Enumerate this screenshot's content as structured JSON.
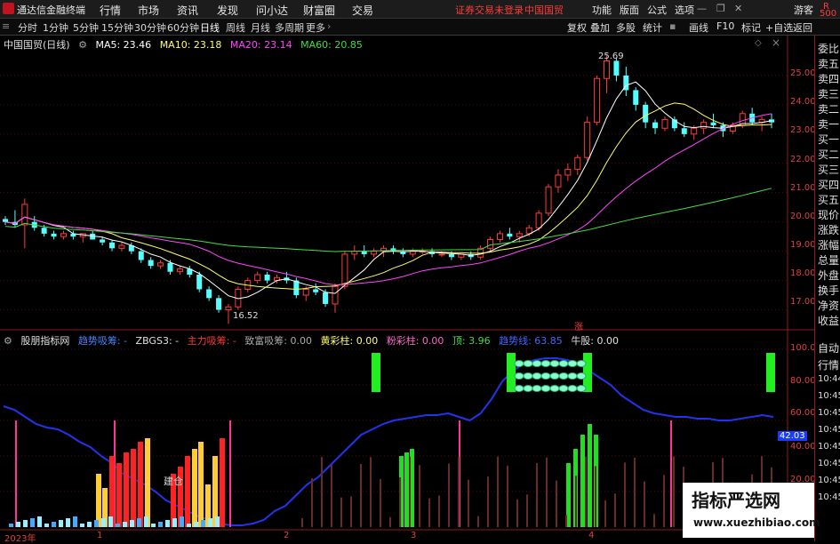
{
  "app": {
    "title": "通达信金融终端"
  },
  "menu": [
    "行情",
    "市场",
    "资讯",
    "发现",
    "问小达",
    "财富圈",
    "交易"
  ],
  "status": {
    "login": "证券交易未登录",
    "stock": "中国国贸"
  },
  "menu_right": [
    "功能",
    "版面",
    "公式",
    "选项"
  ],
  "guest": "游客",
  "periods": [
    "分时",
    "1分钟",
    "5分钟",
    "15分钟",
    "30分钟",
    "60分钟",
    "日线",
    "周线",
    "月线",
    "多周期",
    "更多"
  ],
  "toolbar_right": [
    "复权",
    "叠加",
    "多股",
    "统计",
    "画线",
    "F10",
    "标记",
    "+自选",
    "返回"
  ],
  "main_info": {
    "stock": "中国国贸(日线)",
    "ma5": "MA5: 23.46",
    "ma10": "MA10: 23.18",
    "ma20": "MA20: 23.14",
    "ma60": "MA60: 20.85"
  },
  "sub_info": {
    "name": "股朋指标网",
    "trend": "趋势吸筹: -",
    "zbgs": "ZBGS3: -",
    "main": "主力吸筹: -",
    "rich": "致富吸筹: 0.00",
    "yellow": "黄彩柱: 0.00",
    "pink": "粉彩柱: 0.00",
    "top": "顶: 3.96",
    "trendline": "趋势线: 63.85",
    "bull": "牛股: 0.00"
  },
  "price_axis": [
    "25.00",
    "24.00",
    "23.00",
    "22.00",
    "21.00",
    "20.00",
    "19.00",
    "18.00",
    "17.00"
  ],
  "ind_axis": [
    "100.0",
    "80.00",
    "60.00",
    "40.00",
    "20.00"
  ],
  "ind_value": "42.03",
  "right_panel": [
    "委比",
    "卖五",
    "卖四",
    "卖三",
    "卖二",
    "卖一",
    "买一",
    "买二",
    "买三",
    "买四",
    "买五",
    "现价",
    "涨跌",
    "涨幅",
    "总量",
    "外盘",
    "换手",
    "净资",
    "收益"
  ],
  "right_panel2": [
    "自动",
    "行情",
    "10:44",
    "10:45",
    "10:45",
    "10:45",
    "10:45",
    "10:45",
    "10:45",
    "10:45"
  ],
  "rp_top": "R",
  "rp_top2": "500",
  "dates": [
    "2023年",
    "1",
    "2",
    "3",
    "4"
  ],
  "annotations": {
    "high": "25.69",
    "low": "16.52",
    "zhang": "涨",
    "jiancang": "建仓"
  },
  "watermark": {
    "line1": "指标严选网",
    "line2": "www.xuezhibiao.com"
  },
  "colors": {
    "up": "#ff3b3b",
    "down": "#54ffff",
    "ma5": "#ffffff",
    "ma10": "#ffff66",
    "ma20": "#ff44ff",
    "ma60": "#44dd44",
    "trend": "#2233ee"
  },
  "chart_data": {
    "type": "candlestick",
    "ylim": [
      16.5,
      26.0
    ],
    "candles": [
      [
        20.1,
        20.2,
        19.9,
        20.0
      ],
      [
        20.0,
        20.4,
        19.8,
        19.9
      ],
      [
        19.9,
        20.8,
        19.1,
        20.6
      ],
      [
        20.0,
        20.2,
        19.7,
        19.8
      ],
      [
        19.8,
        19.9,
        19.5,
        19.6
      ],
      [
        19.6,
        19.7,
        19.4,
        19.5
      ],
      [
        19.5,
        19.7,
        19.4,
        19.6
      ],
      [
        19.6,
        19.7,
        19.4,
        19.5
      ],
      [
        19.5,
        19.6,
        19.3,
        19.6
      ],
      [
        19.6,
        19.7,
        19.4,
        19.4
      ],
      [
        19.4,
        19.5,
        19.2,
        19.3
      ],
      [
        19.3,
        19.4,
        19.0,
        19.1
      ],
      [
        19.1,
        19.3,
        19.0,
        19.2
      ],
      [
        19.2,
        19.3,
        18.9,
        19.0
      ],
      [
        19.0,
        19.1,
        18.6,
        18.7
      ],
      [
        18.7,
        18.8,
        18.4,
        18.5
      ],
      [
        18.5,
        18.7,
        18.4,
        18.6
      ],
      [
        18.6,
        18.7,
        18.2,
        18.3
      ],
      [
        18.3,
        18.5,
        18.2,
        18.4
      ],
      [
        18.4,
        18.5,
        18.1,
        18.2
      ],
      [
        18.2,
        18.3,
        17.6,
        17.7
      ],
      [
        17.7,
        17.8,
        17.3,
        17.4
      ],
      [
        17.4,
        17.5,
        16.9,
        17.0
      ],
      [
        17.0,
        17.2,
        16.52,
        17.1
      ],
      [
        17.1,
        17.8,
        17.0,
        17.7
      ],
      [
        17.7,
        18.1,
        17.6,
        18.0
      ],
      [
        18.0,
        18.3,
        17.9,
        18.2
      ],
      [
        18.2,
        18.3,
        17.9,
        18.0
      ],
      [
        18.0,
        18.2,
        17.9,
        18.1
      ],
      [
        18.1,
        18.3,
        17.9,
        18.0
      ],
      [
        18.0,
        18.1,
        17.4,
        17.5
      ],
      [
        17.5,
        17.8,
        17.3,
        17.7
      ],
      [
        17.7,
        17.9,
        17.5,
        17.6
      ],
      [
        17.6,
        17.7,
        17.1,
        17.2
      ],
      [
        17.2,
        17.9,
        16.9,
        17.8
      ],
      [
        17.8,
        19.0,
        17.7,
        18.9
      ],
      [
        18.9,
        19.2,
        18.7,
        19.0
      ],
      [
        19.0,
        19.2,
        18.8,
        18.9
      ],
      [
        18.9,
        19.1,
        18.8,
        19.0
      ],
      [
        19.0,
        19.2,
        18.8,
        19.1
      ],
      [
        19.1,
        19.2,
        18.9,
        19.0
      ],
      [
        19.0,
        19.1,
        18.8,
        18.9
      ],
      [
        18.9,
        19.1,
        18.8,
        19.0
      ],
      [
        19.0,
        19.1,
        18.9,
        19.0
      ],
      [
        19.0,
        19.1,
        18.8,
        18.9
      ],
      [
        18.9,
        19.0,
        18.8,
        18.9
      ],
      [
        18.9,
        19.0,
        18.7,
        18.8
      ],
      [
        18.8,
        18.9,
        18.7,
        18.9
      ],
      [
        18.9,
        19.0,
        18.7,
        18.8
      ],
      [
        18.8,
        19.2,
        18.7,
        19.1
      ],
      [
        19.1,
        19.5,
        19.0,
        19.4
      ],
      [
        19.4,
        19.7,
        19.3,
        19.6
      ],
      [
        19.6,
        19.8,
        19.4,
        19.5
      ],
      [
        19.5,
        19.7,
        19.3,
        19.6
      ],
      [
        19.6,
        19.9,
        19.5,
        19.8
      ],
      [
        19.8,
        20.4,
        19.7,
        20.3
      ],
      [
        20.3,
        21.3,
        20.2,
        21.2
      ],
      [
        21.2,
        21.8,
        21.0,
        21.6
      ],
      [
        21.6,
        22.0,
        21.4,
        21.8
      ],
      [
        21.8,
        22.3,
        21.6,
        22.2
      ],
      [
        22.2,
        23.6,
        22.1,
        23.4
      ],
      [
        23.4,
        25.0,
        23.3,
        24.9
      ],
      [
        24.9,
        25.69,
        24.4,
        25.5
      ],
      [
        25.5,
        25.6,
        24.8,
        25.0
      ],
      [
        25.0,
        25.3,
        24.3,
        24.5
      ],
      [
        24.5,
        24.6,
        23.8,
        24.0
      ],
      [
        24.0,
        24.1,
        23.2,
        23.4
      ],
      [
        23.4,
        23.5,
        23.0,
        23.2
      ],
      [
        23.2,
        23.6,
        23.1,
        23.5
      ],
      [
        23.5,
        23.6,
        23.1,
        23.2
      ],
      [
        23.2,
        23.4,
        22.9,
        23.0
      ],
      [
        23.0,
        23.3,
        22.8,
        23.2
      ],
      [
        23.2,
        23.5,
        23.0,
        23.4
      ],
      [
        23.4,
        23.7,
        23.2,
        23.3
      ],
      [
        23.3,
        23.4,
        22.9,
        23.1
      ],
      [
        23.1,
        23.4,
        23.0,
        23.3
      ],
      [
        23.3,
        23.8,
        23.2,
        23.7
      ],
      [
        23.7,
        23.9,
        23.3,
        23.4
      ],
      [
        23.4,
        23.6,
        23.1,
        23.5
      ],
      [
        23.5,
        23.7,
        23.2,
        23.4
      ]
    ]
  }
}
